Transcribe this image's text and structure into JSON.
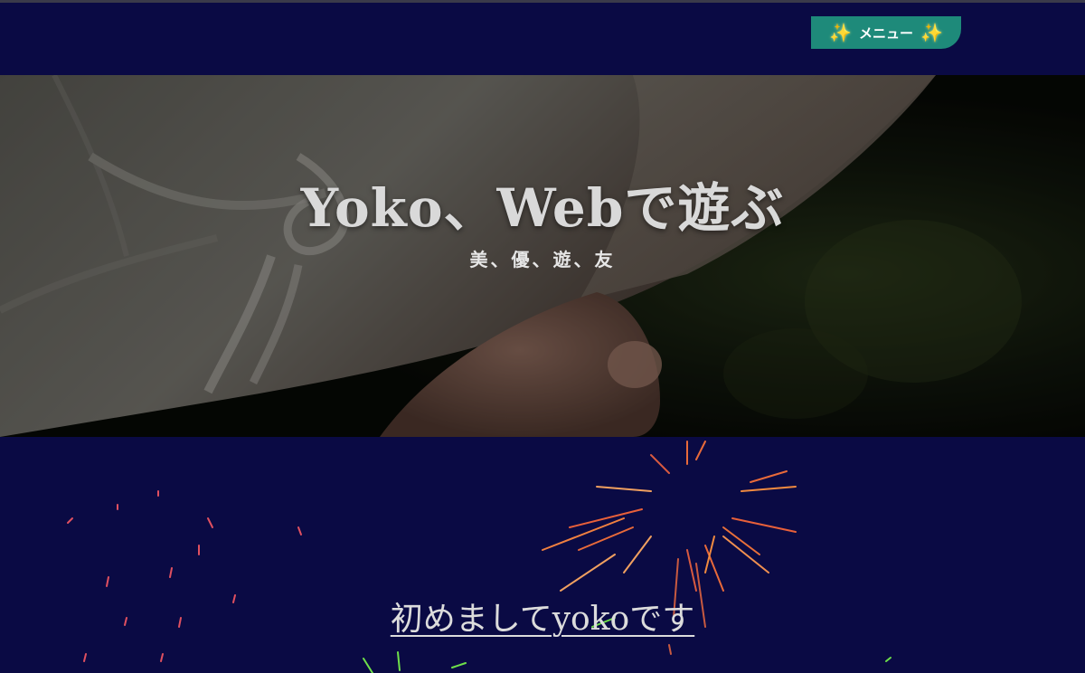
{
  "header": {
    "menu_label": "メニュー",
    "menu_icon": "sparkles-icon",
    "background_color": "#0a0a44",
    "menu_color": "#1e8a7a"
  },
  "hero": {
    "title": "Yoko、Webで遊ぶ",
    "subtitle": "美、優、遊、友",
    "image": "child-in-bucket-hat-photo"
  },
  "content": {
    "heading": "初めましてyokoです",
    "decoration": "fireworks-animation"
  },
  "colors": {
    "page_background": "#0a0a44",
    "accent": "#1e8a7a",
    "sparkle": "#ffd84a"
  }
}
